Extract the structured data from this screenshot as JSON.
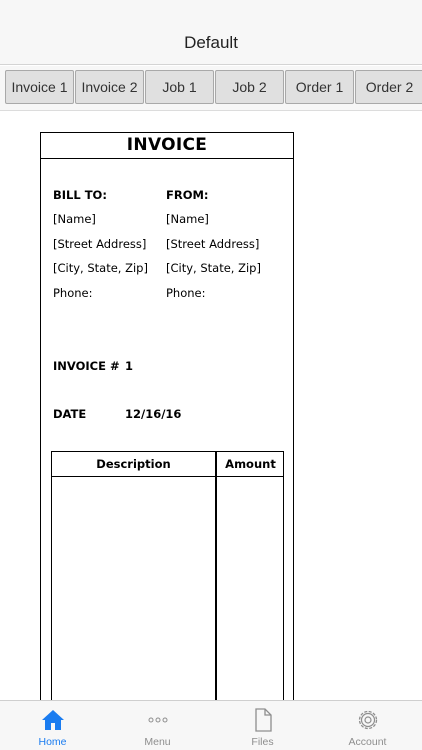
{
  "navbar": {
    "title": "Default"
  },
  "tabs": [
    {
      "label": "Invoice 1"
    },
    {
      "label": "Invoice 2"
    },
    {
      "label": "Job 1"
    },
    {
      "label": "Job 2"
    },
    {
      "label": "Order 1"
    },
    {
      "label": "Order 2"
    }
  ],
  "invoice": {
    "title": "INVOICE",
    "bill_to": {
      "heading": "BILL TO:",
      "name": "[Name]",
      "street": "[Street Address]",
      "city": "[City, State, Zip]",
      "phone": "Phone:"
    },
    "from": {
      "heading": "FROM:",
      "name": "[Name]",
      "street": "[Street Address]",
      "city": "[City, State, Zip]",
      "phone": "Phone:"
    },
    "invoice_number_label": "INVOICE #",
    "invoice_number_value": "1",
    "date_label": "DATE",
    "date_value": "12/16/16",
    "table": {
      "col_description": "Description",
      "col_amount": "Amount"
    }
  },
  "tabbar": {
    "items": [
      {
        "label": "Home",
        "icon": "home-icon"
      },
      {
        "label": "Menu",
        "icon": "more-dots-icon"
      },
      {
        "label": "Files",
        "icon": "file-icon"
      },
      {
        "label": "Account",
        "icon": "gear-icon"
      }
    ],
    "active_color": "#1a7cf0",
    "inactive_color": "#8e8e8e"
  }
}
